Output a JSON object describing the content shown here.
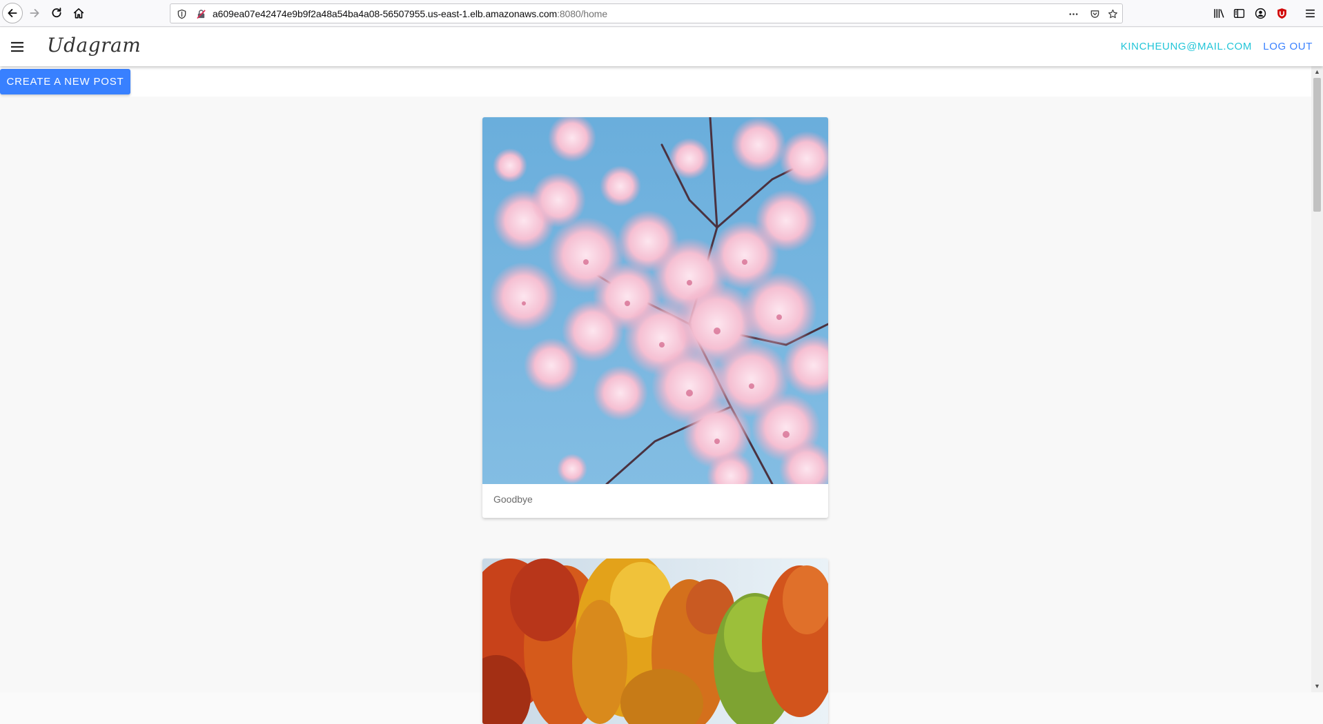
{
  "browser": {
    "url_host": "a609ea07e42474e9b9f2a48a54ba4a08-56507955.us-east-1.elb.amazonaws.com",
    "url_path": ":8080/home"
  },
  "app": {
    "brand": "Udagram",
    "user_email": "KINCHEUNG@MAIL.COM",
    "logout_label": "LOG OUT",
    "create_post_label": "CREATE A NEW POST",
    "accent_color": "#3880ff",
    "email_color": "#21c5d8"
  },
  "posts": [
    {
      "caption": "Goodbye",
      "image": "cherry-blossom-photo"
    },
    {
      "caption": "",
      "image": "autumn-trees-photo"
    }
  ],
  "icons": [
    "back-icon",
    "forward-icon",
    "reload-icon",
    "home-icon",
    "shield-icon",
    "insecure-lock-icon",
    "more-icon",
    "pocket-icon",
    "bookmark-star-icon",
    "library-icon",
    "sidebar-icon",
    "account-icon",
    "ublock-icon",
    "hamburger-menu-icon"
  ]
}
